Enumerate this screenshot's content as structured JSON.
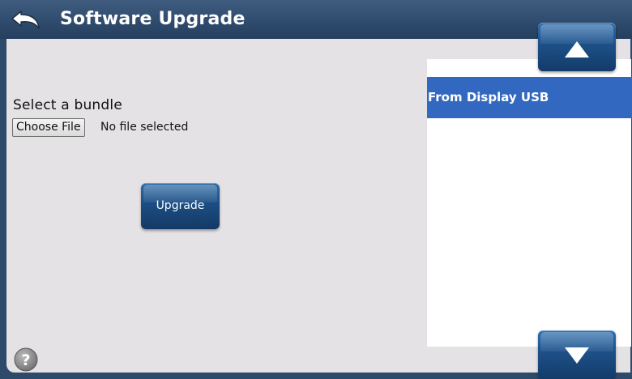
{
  "header": {
    "title": "Software Upgrade",
    "back_icon": "back-arrow-icon"
  },
  "upgrade_form": {
    "label": "Select a bundle",
    "choose_file_label": "Choose File",
    "file_status": "No file selected",
    "upgrade_label": "Upgrade"
  },
  "source_list": {
    "items": [
      {
        "label": "From Display USB",
        "selected": true
      }
    ],
    "scroll_up_icon": "triangle-up-icon",
    "scroll_down_icon": "triangle-down-icon"
  },
  "footer": {
    "help_icon": "help-icon"
  },
  "colors": {
    "titlebar": "#2f4b6d",
    "panel": "#e4e2e5",
    "selection": "#3268bf",
    "button": "#1c4d82"
  }
}
